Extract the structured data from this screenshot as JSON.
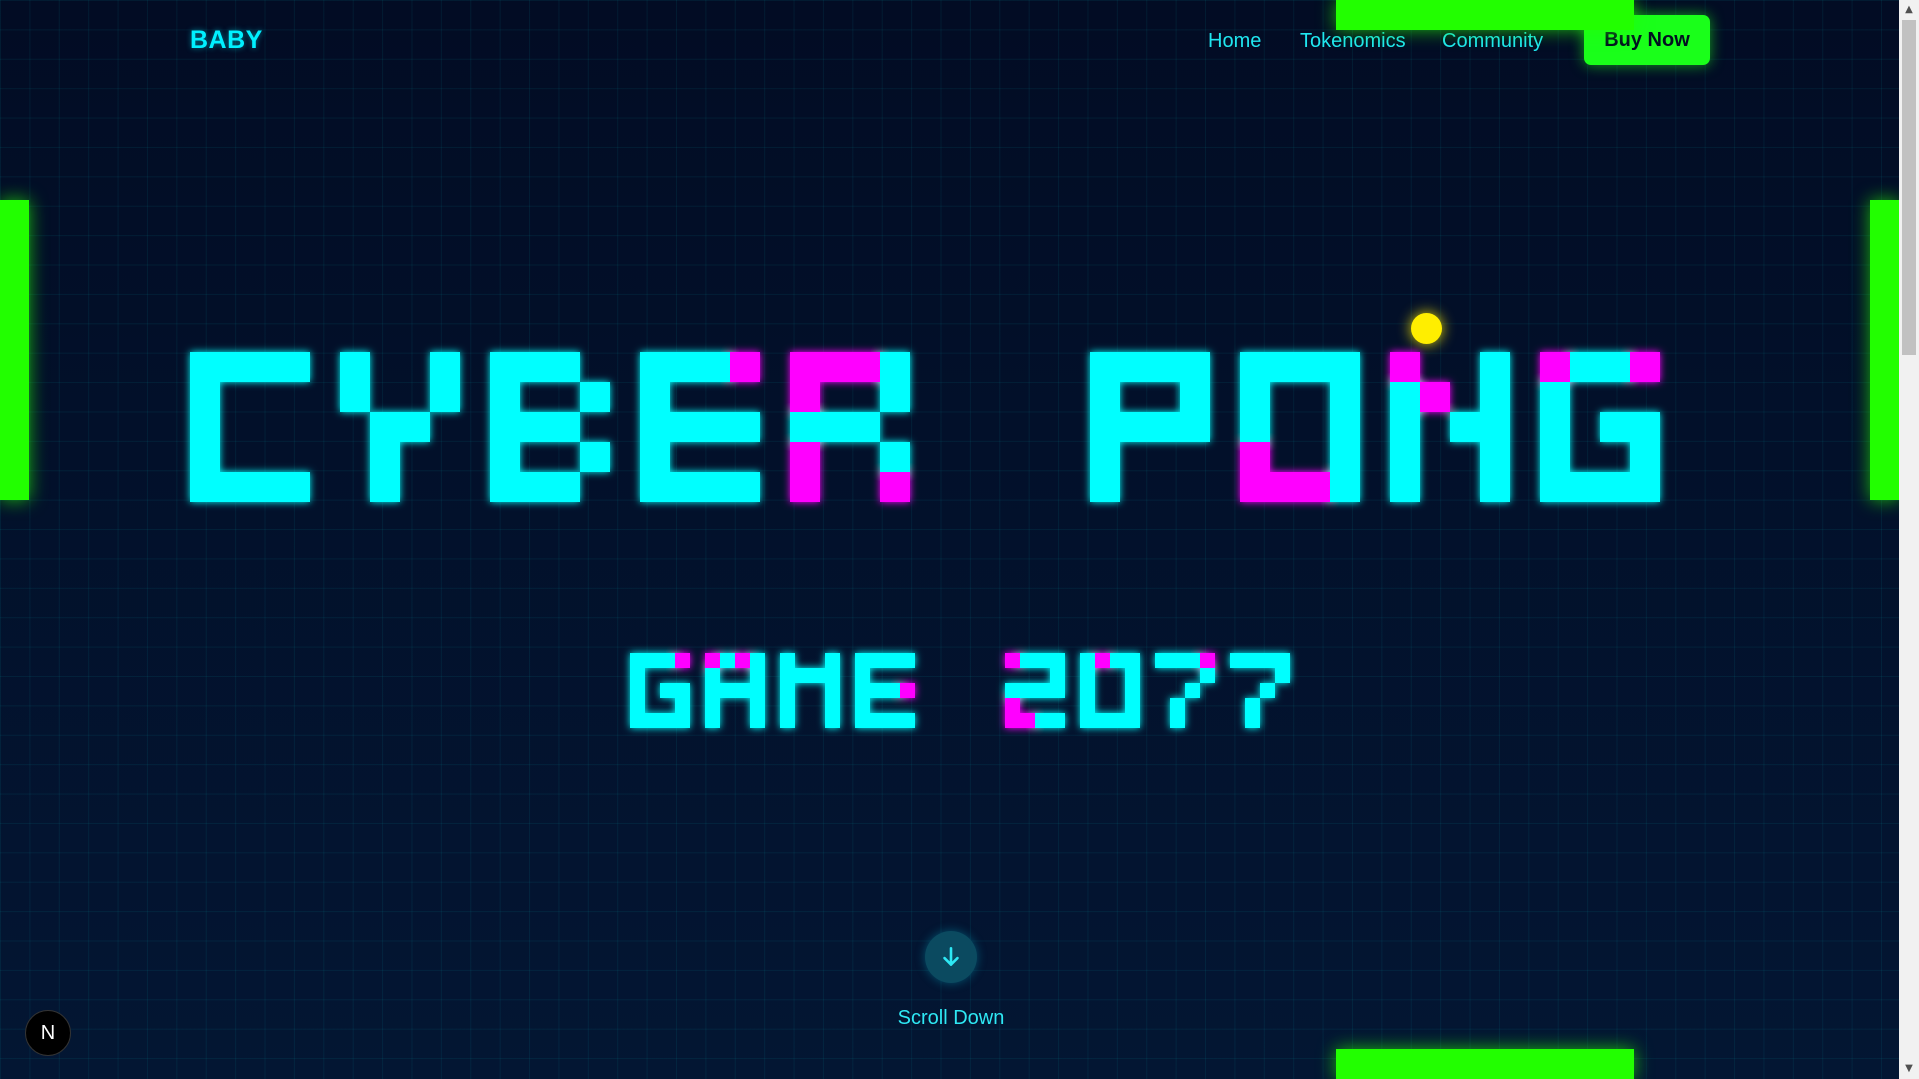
{
  "brand": {
    "logo": "BABY"
  },
  "nav": {
    "items": [
      {
        "label": "Home"
      },
      {
        "label": "Tokenomics"
      },
      {
        "label": "Community"
      }
    ],
    "cta": "Buy Now"
  },
  "hero": {
    "title": "CYBER PONG",
    "subtitle": "GAME 2077"
  },
  "scroll": {
    "label": "Scroll Down"
  },
  "badge": {
    "letter": "N"
  },
  "colors": {
    "cyan": "#00ffff",
    "magenta": "#ff00ff",
    "green": "#22ff00",
    "ball": "#ffee00",
    "background": "#020c24"
  },
  "icons": {
    "scroll": "arrow-down-icon",
    "badge": "nextjs-icon"
  }
}
